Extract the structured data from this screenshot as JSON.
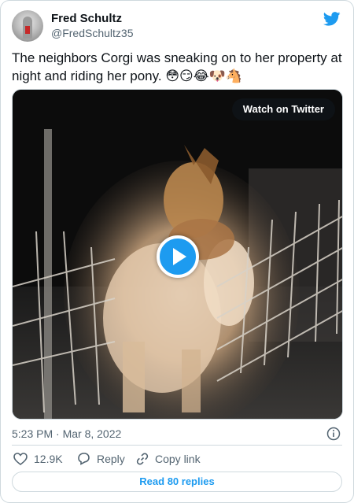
{
  "author": {
    "name": "Fred Schultz",
    "handle": "@FredSchultz35"
  },
  "tweet": {
    "text": "The neighbors Corgi was sneaking on to her property at night and riding her pony. 😳😏😂🐶🐴"
  },
  "media": {
    "watch_label": "Watch on Twitter",
    "play_icon": "play-icon"
  },
  "meta": {
    "timestamp": "5:23 PM · Mar 8, 2022"
  },
  "actions": {
    "likes": "12.9K",
    "reply_label": "Reply",
    "copy_link_label": "Copy link"
  },
  "footer": {
    "read_replies_label": "Read 80 replies"
  },
  "colors": {
    "accent": "#1d9bf0",
    "muted_text": "#536471",
    "border": "#cfd9de"
  }
}
